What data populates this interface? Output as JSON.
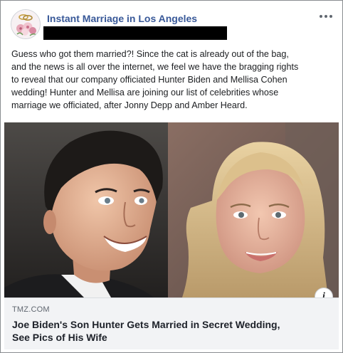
{
  "post": {
    "page_name": "Instant Marriage in Los Angeles",
    "avatar_icon": "wedding-flowers-rings-avatar",
    "more_icon": "more-options-dots-icon",
    "text_lines": [
      "Guess who got them married?! Since the cat is already out of the bag,",
      "and the news is all over the internet, we feel we have the bragging rights",
      "to reveal that our company officiated Hunter Biden and Mellisa Cohen",
      "wedding! Hunter and Mellisa are joining our list of celebrities whose",
      "marriage we officiated, after Jonny Depp and Amber Heard."
    ]
  },
  "link_preview": {
    "info_icon": "info-icon",
    "info_glyph": "i",
    "domain": "TMZ.COM",
    "headline_lines": [
      "Joe Biden's Son Hunter Gets Married in Secret Wedding,",
      "See Pics of His Wife"
    ]
  },
  "colors": {
    "page_name": "#385898",
    "link_footer_bg": "#f2f3f5",
    "text": "#1c1e21"
  }
}
